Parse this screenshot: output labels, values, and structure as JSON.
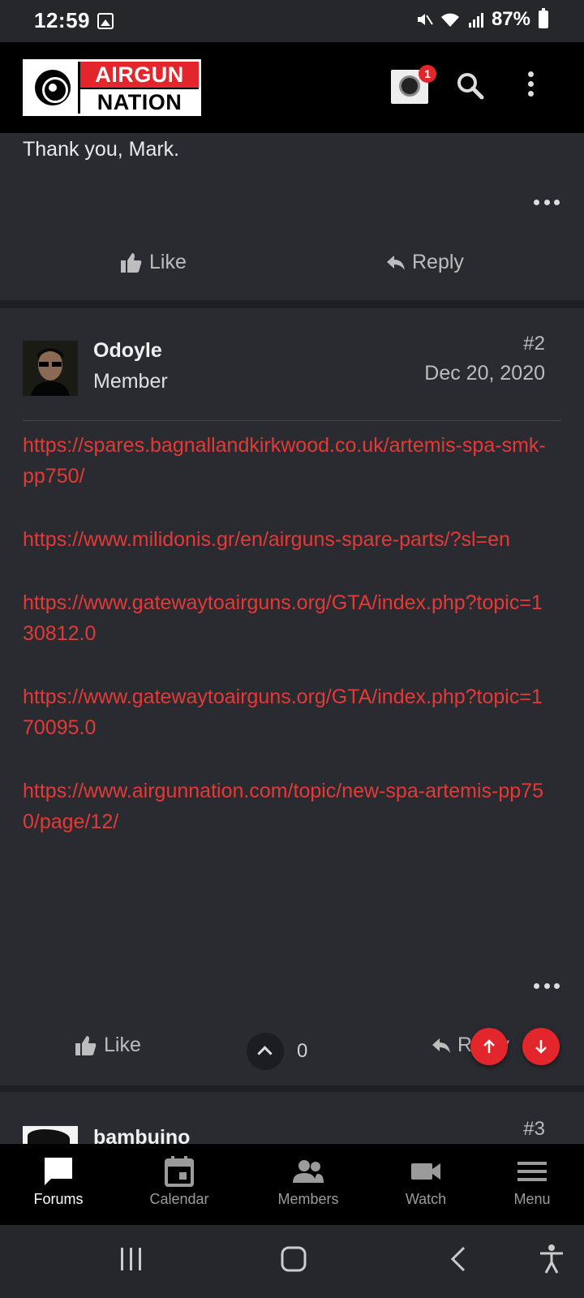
{
  "status": {
    "time": "12:59",
    "battery": "87%"
  },
  "header": {
    "logo_line1": "AIRGUN",
    "logo_line2": "NATION",
    "notification_count": "1"
  },
  "post1": {
    "text": "Thank you, Mark.",
    "like_label": "Like",
    "reply_label": "Reply"
  },
  "post2": {
    "username": "Odoyle",
    "role": "Member",
    "number": "#2",
    "date": "Dec 20, 2020",
    "links": [
      "https://spares.bagnallandkirkwood.co.uk/artemis-spa-smk-pp750/",
      "https://www.milidonis.gr/en/airguns-spare-parts/?sl=en",
      "https://www.gatewaytoairguns.org/GTA/index.php?topic=130812.0",
      "https://www.gatewaytoairguns.org/GTA/index.php?topic=170095.0",
      "https://www.airgunnation.com/topic/new-spa-artemis-pp750/page/12/"
    ],
    "like_label": "Like",
    "vote_count": "0",
    "reply_label": "Reply"
  },
  "post3": {
    "username": "bambuino",
    "number": "#3"
  },
  "bottom_nav": {
    "items": [
      {
        "label": "Forums",
        "icon": "chat-bubble-icon",
        "active": true
      },
      {
        "label": "Calendar",
        "icon": "calendar-icon",
        "active": false
      },
      {
        "label": "Members",
        "icon": "people-icon",
        "active": false
      },
      {
        "label": "Watch",
        "icon": "video-camera-icon",
        "active": false
      },
      {
        "label": "Menu",
        "icon": "hamburger-menu-icon",
        "active": false
      }
    ]
  },
  "colors": {
    "accent": "#e3262b",
    "link": "#e33a37",
    "background": "#2a2b30"
  }
}
